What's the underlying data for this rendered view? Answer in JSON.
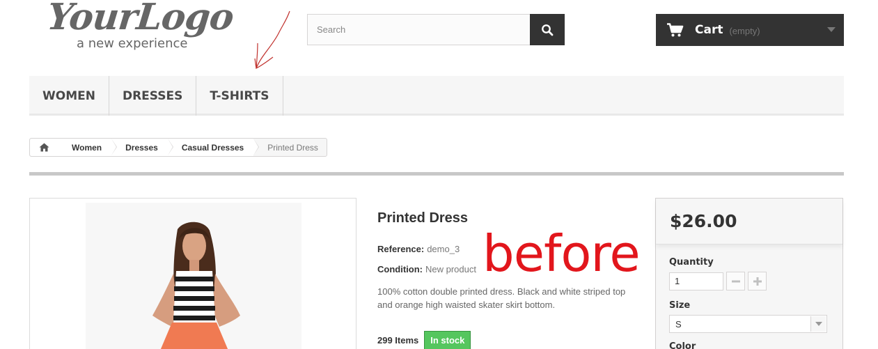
{
  "header": {
    "logo_main": "YourLogo",
    "logo_tagline": "a new experience",
    "search": {
      "placeholder": "Search"
    },
    "cart": {
      "label": "Cart",
      "status": "(empty)"
    }
  },
  "menu": {
    "items": [
      {
        "label": "WOMEN"
      },
      {
        "label": "DRESSES"
      },
      {
        "label": "T-SHIRTS"
      }
    ]
  },
  "breadcrumb": {
    "items": [
      {
        "label": "Women"
      },
      {
        "label": "Dresses"
      },
      {
        "label": "Casual Dresses"
      }
    ],
    "current": "Printed Dress"
  },
  "product": {
    "title": "Printed Dress",
    "reference_label": "Reference:",
    "reference_value": "demo_3",
    "condition_label": "Condition:",
    "condition_value": "New product",
    "description": "100% cotton double printed dress. Black and white striped top and orange high waisted skater skirt bottom.",
    "items_count": "299 Items",
    "stock_status": "In stock"
  },
  "annotation": {
    "text": "before",
    "color": "#e2161c"
  },
  "buy_box": {
    "price": "$26.00",
    "quantity_label": "Quantity",
    "quantity_value": "1",
    "size_label": "Size",
    "size_value": "S",
    "color_label": "Color"
  },
  "colors": {
    "dark": "#333333",
    "stock_green": "#55c65e",
    "annotation_red": "#e2161c"
  }
}
